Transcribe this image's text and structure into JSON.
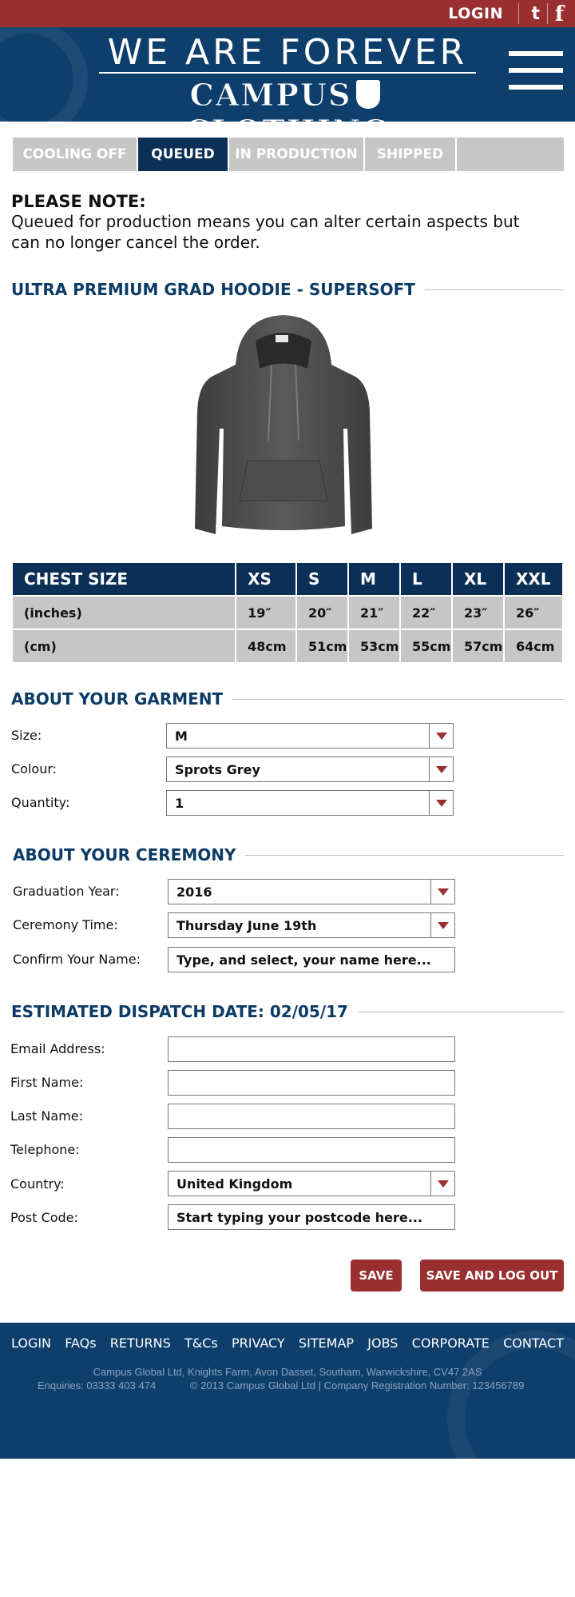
{
  "topbar": {
    "login": "LOGIN",
    "twitter_glyph": "t",
    "facebook_glyph": "f"
  },
  "header": {
    "tagline": "WE ARE FOREVER",
    "brand_left": "CAMPUS",
    "brand_right": "CLOTHING"
  },
  "status_tabs": [
    {
      "label": "COOLING OFF",
      "active": false
    },
    {
      "label": "QUEUED",
      "active": true
    },
    {
      "label": "IN PRODUCTION",
      "active": false
    },
    {
      "label": "SHIPPED",
      "active": false
    }
  ],
  "note": {
    "title": "PLEASE NOTE:",
    "body": "Queued for production means you can alter certain aspects but can no longer cancel the order."
  },
  "product": {
    "title": "ULTRA PREMIUM GRAD HOODIE - SUPERSOFT"
  },
  "size_table": {
    "header": [
      "CHEST SIZE",
      "XS",
      "S",
      "M",
      "L",
      "XL",
      "XXL"
    ],
    "rows": [
      [
        "(inches)",
        "19″",
        "20″",
        "21″",
        "22″",
        "23″",
        "26″"
      ],
      [
        "(cm)",
        "48cm",
        "51cm",
        "53cm",
        "55cm",
        "57cm",
        "64cm"
      ]
    ]
  },
  "garment": {
    "title": "ABOUT YOUR GARMENT",
    "size_label": "Size:",
    "size_value": "M",
    "colour_label": "Colour:",
    "colour_value": "Sprots Grey",
    "quantity_label": "Quantity:",
    "quantity_value": "1"
  },
  "ceremony": {
    "title": "ABOUT YOUR CEREMONY",
    "year_label": "Graduation Year:",
    "year_value": "2016",
    "time_label": "Ceremony Time:",
    "time_value": "Thursday June 19th",
    "name_label": "Confirm Your Name:",
    "name_placeholder": "Type, and select, your name here..."
  },
  "dispatch": {
    "title": "ESTIMATED DISPATCH DATE: 02/05/17",
    "email_label": "Email Address:",
    "first_label": "First Name:",
    "last_label": "Last Name:",
    "phone_label": "Telephone:",
    "country_label": "Country:",
    "country_value": "United Kingdom",
    "postcode_label": "Post Code:",
    "postcode_placeholder": "Start typing your postcode here..."
  },
  "buttons": {
    "save": "SAVE",
    "save_logout": "SAVE AND LOG OUT"
  },
  "footer": {
    "nav": [
      "LOGIN",
      "FAQs",
      "RETURNS",
      "T&Cs",
      "PRIVACY",
      "SITEMAP",
      "JOBS",
      "CORPORATE",
      "CONTACT"
    ],
    "address": "Campus Global Ltd, Knights Farm, Avon Dasset, Southam, Warwickshire, CV47 2AS",
    "enquiries": "Enquiries: 03333 403 474",
    "copyright": "© 2013 Campus Global Ltd | Company Registration Number: 123456789"
  },
  "colors": {
    "navy": "#0c2f57",
    "header_blue": "#0e3f6c",
    "red": "#9a2f30",
    "tab_grey": "#c6c6c6"
  }
}
